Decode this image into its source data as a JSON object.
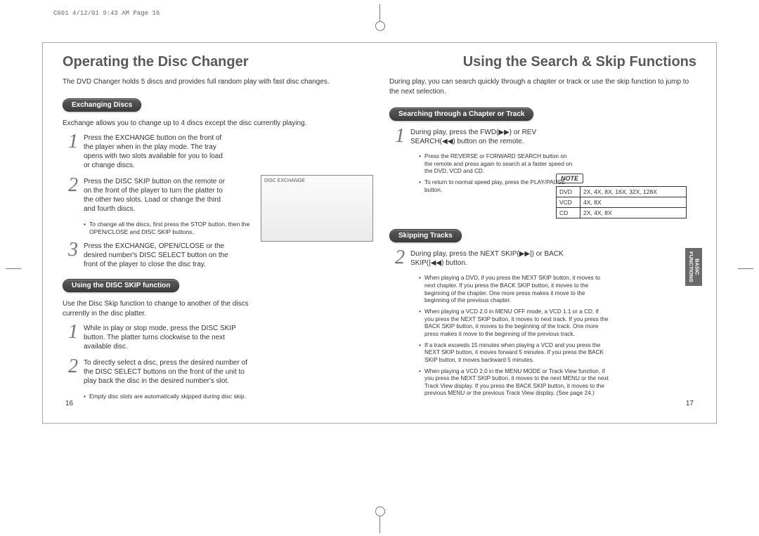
{
  "print_header": "C601  4/12/01 9:43 AM  Page 16",
  "side_tab": "BASIC FUNCTIONS",
  "left": {
    "title": "Operating the Disc Changer",
    "intro": "The DVD Changer holds 5 discs and provides full random play with fast disc changes.",
    "exchanging": {
      "pill": "Exchanging Discs",
      "intro": "Exchange allows you to change up to 4 discs except the disc currently playing.",
      "steps": [
        "Press the EXCHANGE button on the front of the player when in the play mode. The tray opens with two slots available for you to load or change discs.",
        "Press the DISC SKIP button on the remote or on the front of the player to turn the platter to the other two slots. Load or change the third and fourth discs.",
        "Press the EXCHANGE, OPEN/CLOSE or the desired number's DISC SELECT button on the front of the player to close the disc tray."
      ],
      "sub_bullet": "To change all the discs, first press the STOP button, then the OPEN/CLOSE and DISC SKIP buttons.",
      "image_label": "DISC EXCHANGE"
    },
    "discskip": {
      "pill": "Using the DISC SKIP function",
      "intro": "Use the Disc Skip function to change to another of the discs currently in the disc platter.",
      "steps": [
        "While in play or stop mode, press the DISC SKIP button. The platter turns clockwise to the next available disc.",
        "To directly select a disc, press the desired number of the DISC SELECT buttons on the front of the unit to play back the disc in the desired number's slot."
      ],
      "sub_bullet": "Empty disc slots are automatically skipped during disc skip."
    },
    "pagenum": "16"
  },
  "right": {
    "title": "Using the Search & Skip Functions",
    "intro": "During play, you can search quickly through a chapter or track or use the skip function to jump to the next selection.",
    "searching": {
      "pill": "Searching through a Chapter or Track",
      "step": "During play, press the FWD(▶▶) or REV SEARCH(◀◀) button on the remote.",
      "bullets": [
        "Press the REVERSE or FORWARD SEARCH button on the remote and press again to search at a faster speed on the DVD, VCD and CD.",
        "To return to normal speed play, press the PLAY/PAUSE button."
      ]
    },
    "note": {
      "label": "NOTE",
      "rows": [
        {
          "k": "DVD",
          "v": "2X, 4X, 8X, 16X, 32X, 128X"
        },
        {
          "k": "VCD",
          "v": "4X, 8X"
        },
        {
          "k": "CD",
          "v": "2X, 4X, 8X"
        }
      ]
    },
    "skipping": {
      "pill": "Skipping Tracks",
      "step": "During play, press the NEXT SKIP(▶▶|) or BACK SKIP(|◀◀) button.",
      "bullets": [
        "When playing a DVD, if you press the NEXT SKIP button, it moves to next chapter. If you press the BACK SKIP button, it moves to the beginning of the chapter. One more press makes it move to the beginning of the previous chapter.",
        "When playing a VCD 2.0 in MENU OFF mode, a VCD 1.1 or a CD, if you press the NEXT SKIP button, it moves to next track. If you press the BACK SKIP button, it moves to the beginning of the track. One more press makes it move to the beginning of the previous track.",
        "If a track exceeds 15 minutes when playing a VCD and you press the NEXT SKIP button, it moves forward 5 minutes. If you press the BACK SKIP button, it moves backward 5 minutes.",
        "When playing a VCD 2.0 in the MENU MODE or Track View function, if you press the NEXT SKIP button, it moves to the next MENU or the next Track View display. If you press the BACK SKIP button, it moves to the previous MENU or the previous Track View display. (See page 24.)"
      ]
    },
    "pagenum": "17"
  }
}
